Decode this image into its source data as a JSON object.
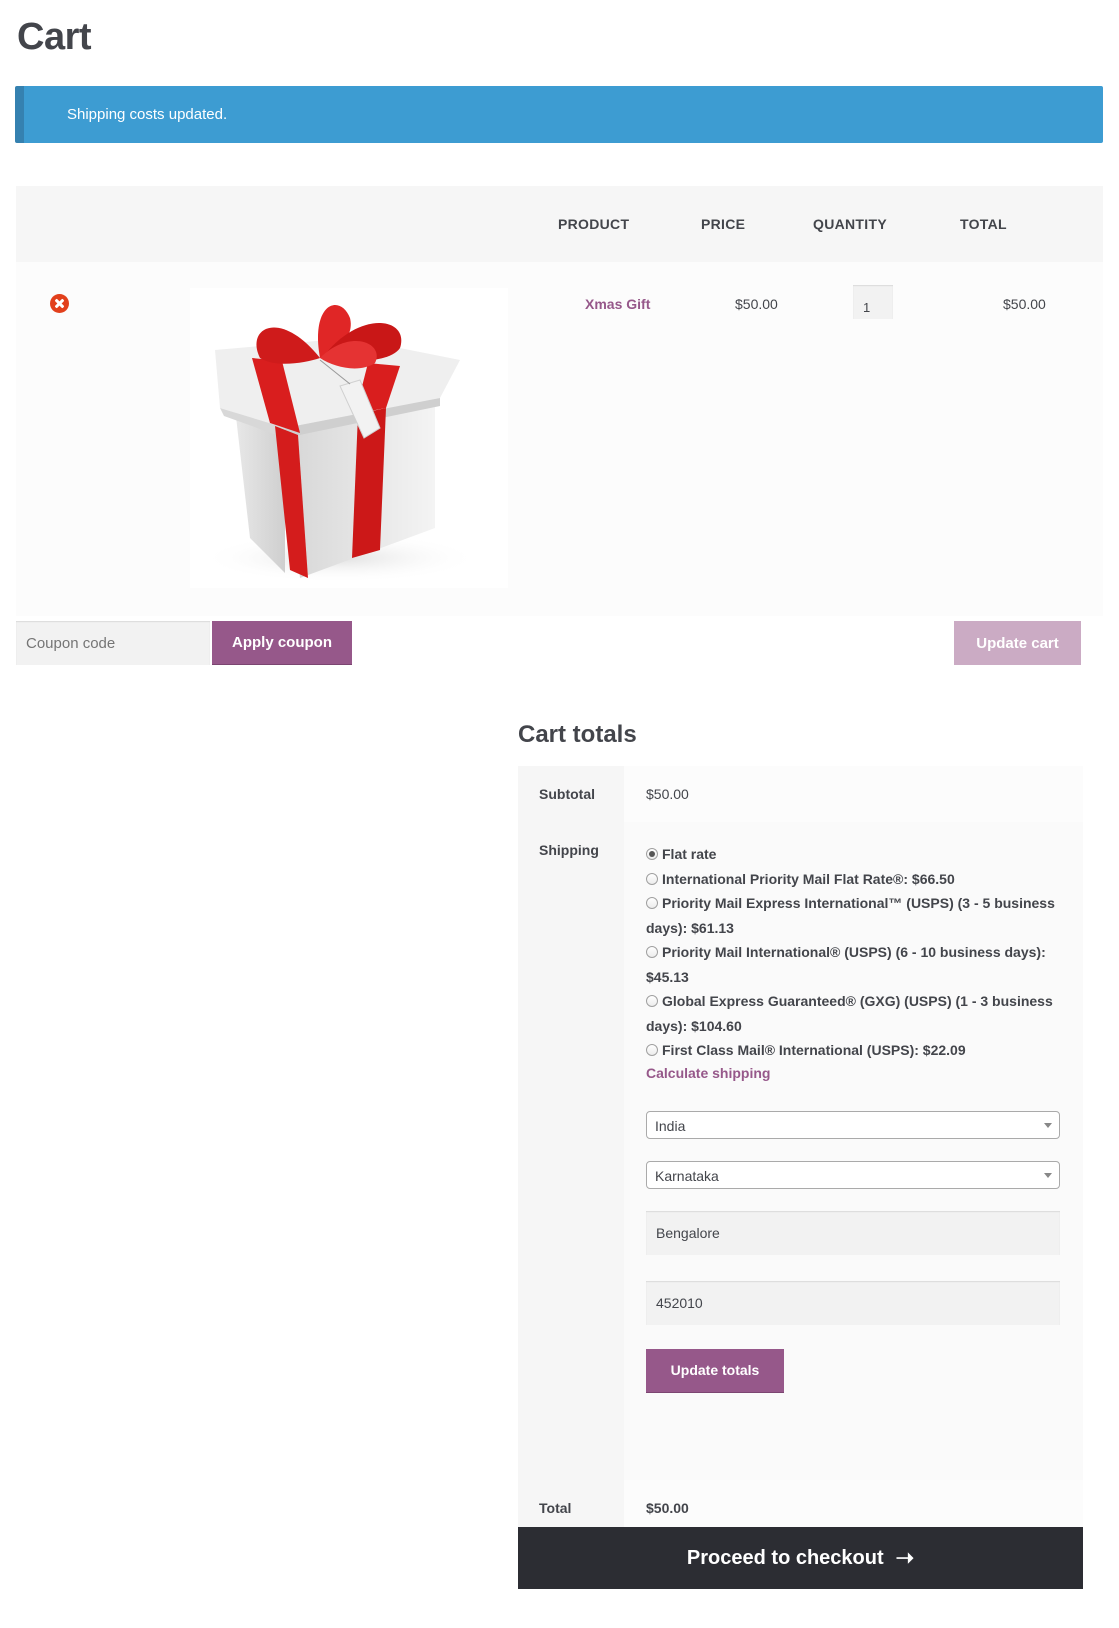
{
  "page": {
    "title": "Cart"
  },
  "notice": {
    "message": "Shipping costs updated.",
    "color": "#3d9cd2"
  },
  "cart_table": {
    "headers": [
      "PRODUCT",
      "PRICE",
      "QUANTITY",
      "TOTAL"
    ],
    "items": [
      {
        "name": "Xmas Gift",
        "image": "gift-box-with-red-ribbon",
        "price": "$50.00",
        "quantity": "1",
        "total": "$50.00"
      }
    ]
  },
  "actions": {
    "coupon_placeholder": "Coupon code",
    "apply_coupon": "Apply coupon",
    "update_cart": "Update cart"
  },
  "totals": {
    "title": "Cart totals",
    "subtotal_label": "Subtotal",
    "subtotal_value": "$50.00",
    "shipping_label": "Shipping",
    "shipping_options": [
      {
        "label": "Flat rate",
        "selected": true
      },
      {
        "label": "International Priority Mail Flat Rate®: $66.50",
        "selected": false
      },
      {
        "label": "Priority Mail Express International™ (USPS) (3 - 5 business days): $61.13",
        "selected": false
      },
      {
        "label": "Priority Mail International® (USPS) (6 - 10 business days): $45.13",
        "selected": false
      },
      {
        "label": "Global Express Guaranteed® (GXG) (USPS) (1 - 3 business days): $104.60",
        "selected": false
      },
      {
        "label": "First Class Mail® International (USPS): $22.09",
        "selected": false
      }
    ],
    "calculate_shipping": "Calculate shipping",
    "country": "India",
    "state": "Karnataka",
    "city": "Bengalore",
    "postcode": "452010",
    "update_totals": "Update totals",
    "total_label": "Total",
    "total_value": "$50.00"
  },
  "checkout": {
    "label": "Proceed to checkout",
    "icon": "arrow-right-icon"
  },
  "colors": {
    "brand": "#96588a",
    "dark": "#2c2d33",
    "remove": "#e2401c"
  }
}
